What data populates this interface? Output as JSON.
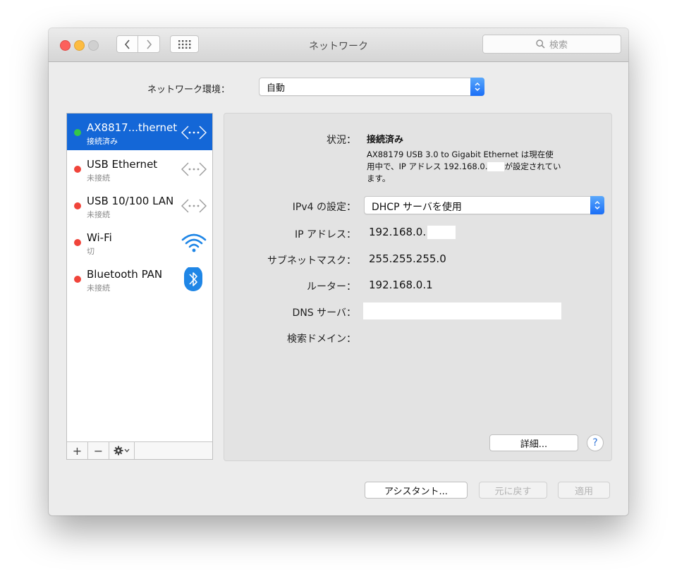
{
  "window": {
    "title": "ネットワーク"
  },
  "toolbar": {
    "search_placeholder": "検索"
  },
  "location": {
    "label": "ネットワーク環境：",
    "value": "自動"
  },
  "services": [
    {
      "name": "AX8817...thernet",
      "status": "接続済み",
      "status_color": "#34c749",
      "icon": "ethernet-icon",
      "selected": true
    },
    {
      "name": "USB Ethernet",
      "status": "未接続",
      "status_color": "#f0443a",
      "icon": "ethernet-icon",
      "selected": false
    },
    {
      "name": "USB 10/100 LAN",
      "status": "未接続",
      "status_color": "#f0443a",
      "icon": "ethernet-icon",
      "selected": false
    },
    {
      "name": "Wi-Fi",
      "status": "切",
      "status_color": "#f0443a",
      "icon": "wifi-icon",
      "selected": false
    },
    {
      "name": "Bluetooth PAN",
      "status": "未接続",
      "status_color": "#f0443a",
      "icon": "bluetooth-icon",
      "selected": false
    }
  ],
  "sidebar_tools": {
    "add": "+",
    "remove": "−"
  },
  "detail": {
    "status_label": "状況：",
    "status_value": "接続済み",
    "status_desc_1": "AX88179 USB 3.0 to Gigabit Ethernet は現在使",
    "status_desc_2a": "用中で、IP アドレス 192.168.0.",
    "status_desc_2b": "が設定されてい",
    "status_desc_3": "ます。",
    "ipv4_label": "IPv4 の設定：",
    "ipv4_value": "DHCP サーバを使用",
    "ip_label": "IP アドレス：",
    "ip_value": "192.168.0.",
    "subnet_label": "サブネットマスク：",
    "subnet_value": "255.255.255.0",
    "router_label": "ルーター：",
    "router_value": "192.168.0.1",
    "dns_label": "DNS サーバ：",
    "search_domain_label": "検索ドメイン：",
    "advanced_button": "詳細...",
    "help_button": "?"
  },
  "footer": {
    "assistant_button": "アシスタント...",
    "revert_button": "元に戻す",
    "apply_button": "適用"
  },
  "colors": {
    "selection": "#1467d7",
    "accent": "#1a6ef7"
  }
}
